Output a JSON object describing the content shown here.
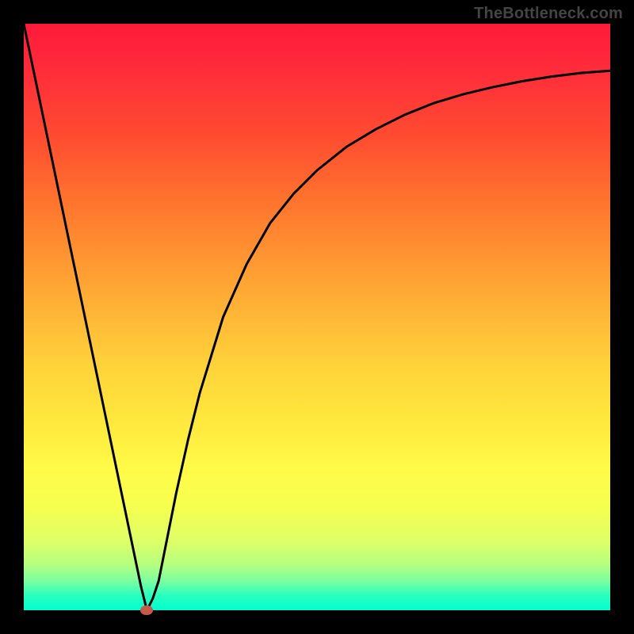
{
  "watermark": "TheBottleneck.com",
  "chart_data": {
    "type": "line",
    "title": "",
    "xlabel": "",
    "ylabel": "",
    "xlim": [
      0,
      100
    ],
    "ylim": [
      0,
      100
    ],
    "grid": false,
    "legend": false,
    "series": [
      {
        "name": "curve",
        "x": [
          0,
          5,
          10,
          15,
          20,
          21,
          22,
          23,
          24,
          25,
          26,
          28,
          30,
          34,
          38,
          42,
          46,
          50,
          55,
          60,
          65,
          70,
          75,
          80,
          85,
          90,
          95,
          100
        ],
        "y": [
          100,
          76,
          52,
          28,
          4,
          0,
          2,
          5,
          10,
          15,
          20,
          29,
          37,
          50,
          59,
          66,
          71,
          75,
          79,
          82,
          84.5,
          86.5,
          88,
          89.2,
          90.2,
          91,
          91.6,
          92
        ]
      }
    ],
    "marker": {
      "x": 21,
      "y": 0,
      "color": "#c65a4a"
    },
    "gradient_stops": [
      {
        "pos": 0.0,
        "color": "#ff1a3a"
      },
      {
        "pos": 0.2,
        "color": "#ff4e30"
      },
      {
        "pos": 0.45,
        "color": "#ffd23a"
      },
      {
        "pos": 0.76,
        "color": "#fffb48"
      },
      {
        "pos": 0.95,
        "color": "#7dffa0"
      },
      {
        "pos": 1.0,
        "color": "#00ffcf"
      }
    ]
  }
}
